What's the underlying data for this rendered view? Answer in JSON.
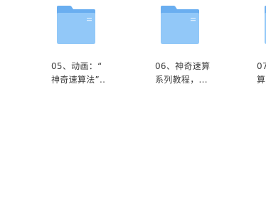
{
  "file_browser": {
    "items": [
      {
        "type": "folder",
        "icon": "folder-icon",
        "label": "05、动画：“\n神奇速算法”.."
      },
      {
        "type": "folder",
        "icon": "folder-icon",
        "label": "06、神奇速算\n系列教程，..."
      },
      {
        "type": "folder",
        "icon": "folder-icon",
        "label": "07\n算"
      }
    ]
  },
  "colors": {
    "folder_back": "#6aaef0",
    "folder_front": "#92c8f8",
    "folder_front_light": "#a9d5fb",
    "label_text": "#3d3d3d",
    "background": "#ffffff"
  }
}
